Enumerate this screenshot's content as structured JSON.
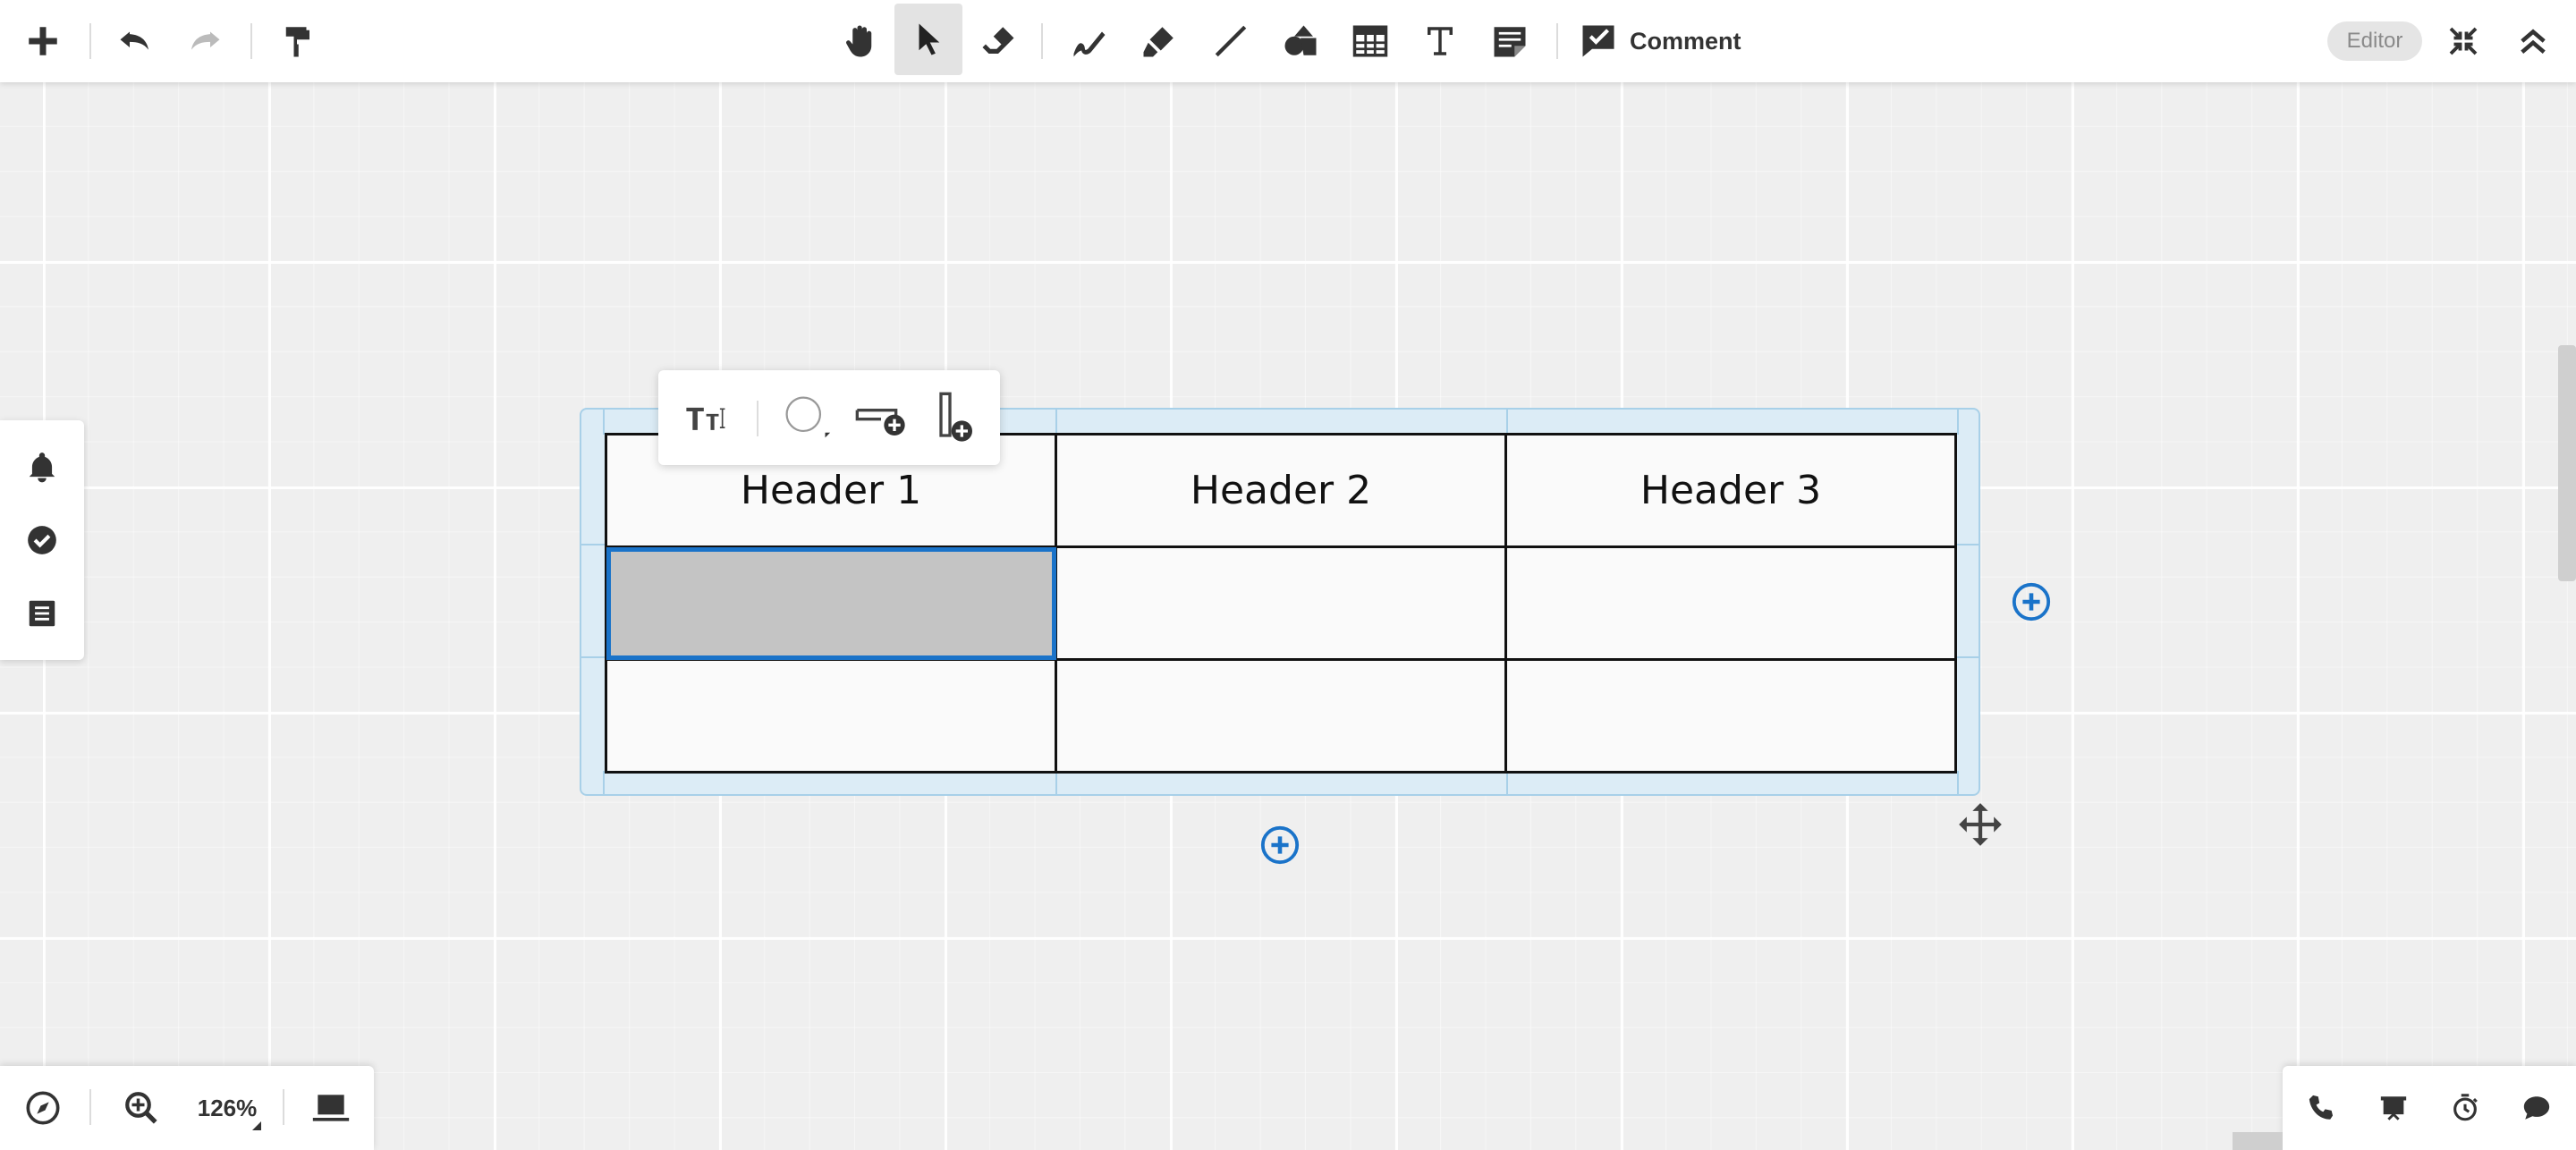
{
  "toolbar": {
    "comment_label": "Comment",
    "editor_label": "Editor",
    "tools": [
      "add-icon",
      "undo-icon",
      "redo-icon",
      "format-painter-icon",
      "hand-icon",
      "pointer-icon",
      "eraser-icon",
      "pen-icon",
      "highlighter-icon",
      "line-icon",
      "shapes-icon",
      "table-icon",
      "text-icon",
      "sticky-note-icon",
      "comment-icon",
      "fit-screen-icon",
      "collapse-icon"
    ],
    "active_tool": "pointer"
  },
  "left_panel": {
    "icons": [
      "bell-icon",
      "check-circle-icon",
      "list-icon"
    ]
  },
  "table": {
    "rows": [
      [
        "Header 1",
        "Header 2",
        "Header 3"
      ],
      [
        "",
        "",
        ""
      ],
      [
        "",
        "",
        ""
      ]
    ],
    "selected_cell": [
      1,
      0
    ]
  },
  "cell_toolbar": {
    "icons": [
      "text-format-icon",
      "fill-color-icon",
      "add-row-icon",
      "add-column-icon"
    ]
  },
  "bottom_left": {
    "zoom_label": "126%"
  },
  "bottom_right": {
    "icons": [
      "phone-icon",
      "present-icon",
      "timer-icon",
      "chat-icon"
    ]
  },
  "colors": {
    "accent": "#1a73c9",
    "frame": "#a8d0e8",
    "selected_fill": "#c4c4c4"
  }
}
